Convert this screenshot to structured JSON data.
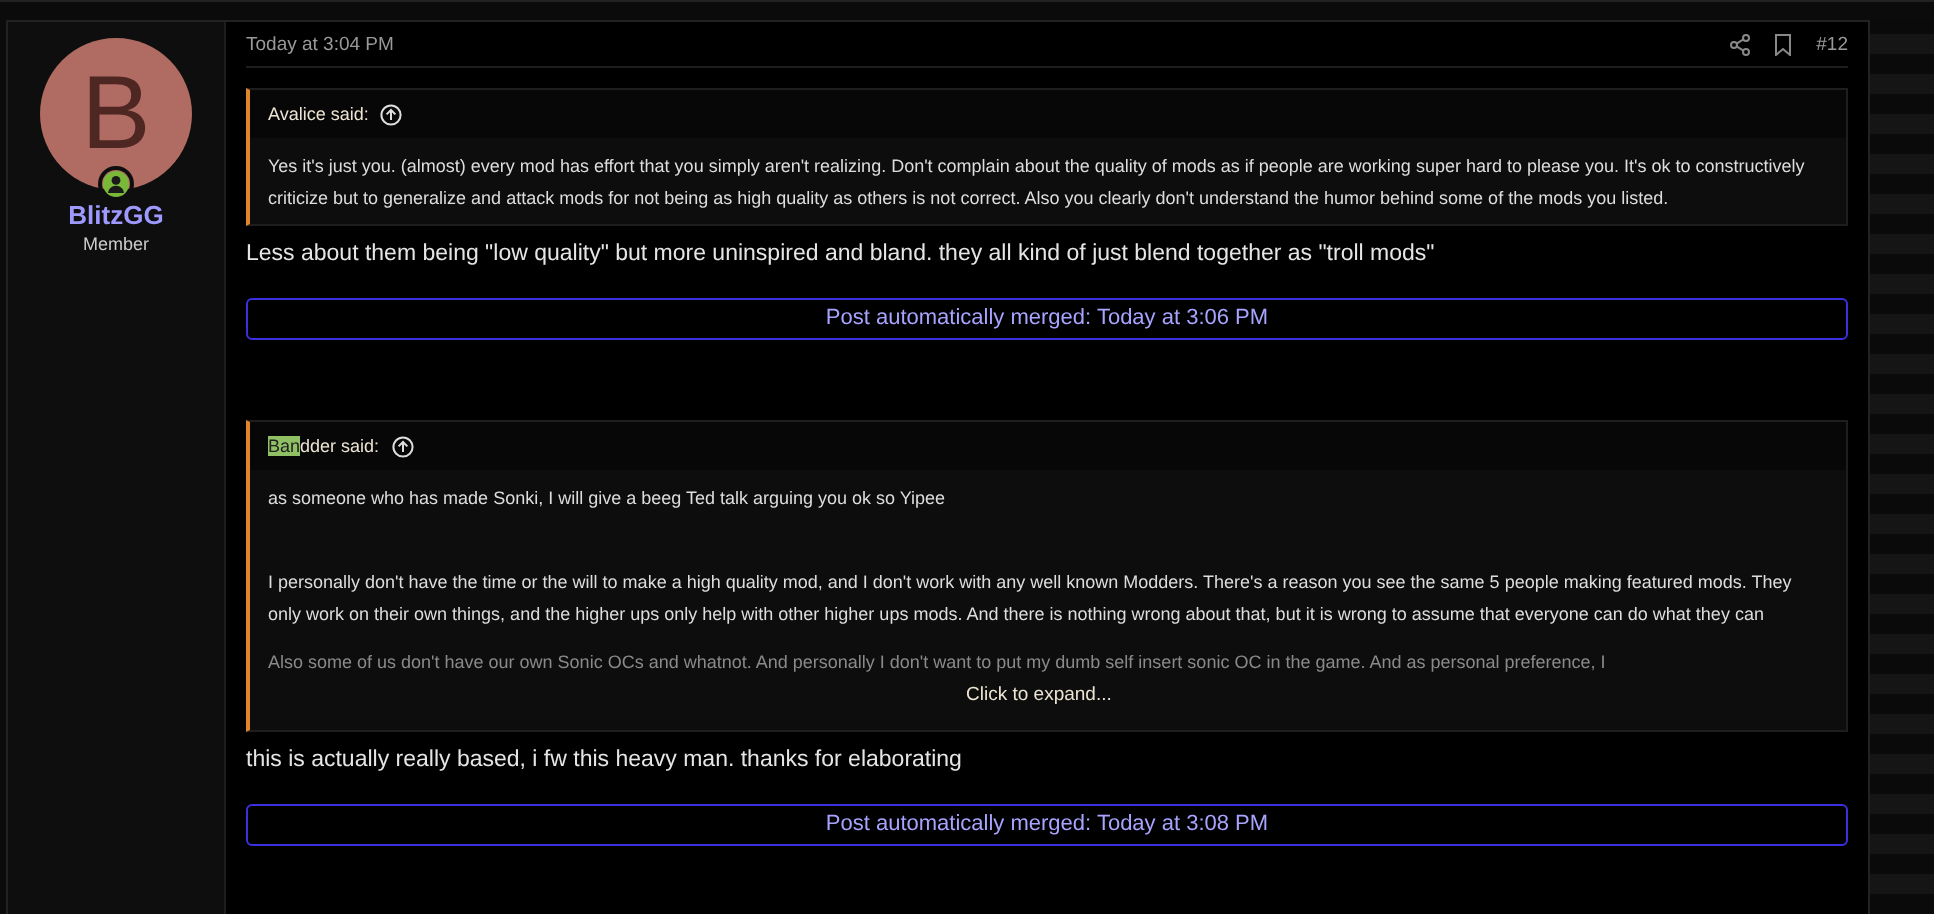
{
  "user": {
    "initial": "B",
    "name": "BlitzGG",
    "role": "Member",
    "online": true
  },
  "post": {
    "time": "Today at 3:04 PM",
    "number": "#12",
    "blocks": [
      {
        "kind": "quote",
        "author": "Avalice said:",
        "paragraphs": [
          "Yes it's just you. (almost) every mod has effort that you simply aren't realizing. Don't complain about the quality of mods as if people are working super hard to please you. It's ok to constructively criticize but to generalize and attack mods for not being as high quality as others is not correct. Also you clearly don't understand the humor behind some of the mods you listed."
        ],
        "collapsed": false
      },
      {
        "kind": "text",
        "text": "Less about them being \"low quality\" but more uninspired and bland. they all kind of just blend together as \"troll mods\""
      },
      {
        "kind": "merged",
        "text": "Post automatically merged: Today at 3:06 PM"
      },
      {
        "kind": "quote",
        "author_highlight": "Ban",
        "author": "dder said:",
        "paragraphs": [
          "as someone who has made Sonki, I will give a beeg Ted talk arguing you ok so Yipee",
          "I personally don't have the time or the will to make a high quality mod, and I don't work with any well known Modders. There's a reason you see the same 5 people making featured mods. They only work on their own things, and the higher ups only help with other higher ups mods. And there is nothing wrong about that, but it is wrong to assume that everyone can do what they can",
          "Also some of us don't have our own Sonic OCs and whatnot. And personally I don't want to put my dumb self insert sonic OC in the game. And as personal preference, I"
        ],
        "collapsed": true,
        "expand_label": "Click to expand..."
      },
      {
        "kind": "text",
        "text": "this is actually really based, i fw this heavy man. thanks for elaborating"
      },
      {
        "kind": "merged",
        "text": "Post automatically merged: Today at 3:08 PM"
      }
    ]
  }
}
